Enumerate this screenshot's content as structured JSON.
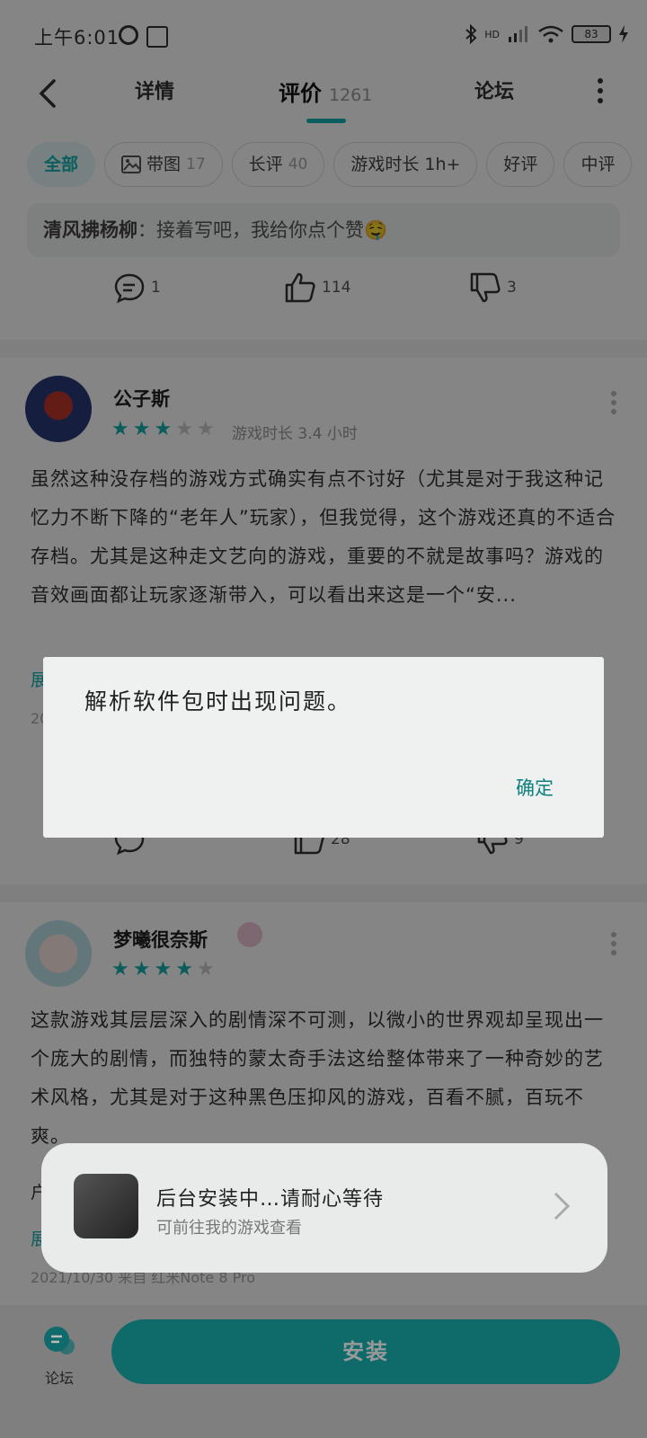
{
  "status": {
    "time": "上午6:01",
    "battery": "83",
    "network": "HD"
  },
  "nav": {
    "tabs": [
      {
        "label": "详情"
      },
      {
        "label": "评价",
        "count": "1261"
      },
      {
        "label": "论坛"
      }
    ]
  },
  "filters": [
    {
      "label": "全部",
      "active": true
    },
    {
      "label": "带图",
      "count": "17"
    },
    {
      "label": "长评",
      "count": "40"
    },
    {
      "label": "游戏时长 1h+"
    },
    {
      "label": "好评"
    },
    {
      "label": "中评"
    }
  ],
  "prev_review": {
    "reply_user": "清风拂杨柳",
    "reply_text": "接着写吧，我给你点个赞🤤",
    "comments": "1",
    "likes": "114",
    "dislikes": "3"
  },
  "review1": {
    "username": "公子斯",
    "rating": 3,
    "playtime": "游戏时长 3.4 小时",
    "text": "虽然这种没存档的游戏方式确实有点不讨好（尤其是对于我这种记忆力不断下降的“老年人”玩家），但我觉得，这个游戏还真的不适合存档。尤其是这种走文艺向的游戏，重要的不就是故事吗？游戏的音效画面都让玩家逐渐带入，可以看出来这是一个“安...",
    "fold": "展",
    "meta": "20",
    "likes": "28",
    "dislikes": "9"
  },
  "review2": {
    "username": "梦曦很奈斯",
    "rating": 4,
    "text": "这款游戏其层层深入的剧情深不可测，以微小的世界观却呈现出一个庞大的剧情，而独特的蒙太奇手法这给整体带来了一种奇妙的艺术风格，尤其是对于这种黑色压抑风的游戏，百看不腻，百玩不爽。",
    "line5_a": "户",
    "line6_a": "展",
    "meta": "2021/10/30  来自 红米Note 8 Pro"
  },
  "dialog": {
    "message": "解析软件包时出现问题。",
    "ok": "确定"
  },
  "toast": {
    "title": "后台安装中…请耐心等待",
    "subtitle": "可前往我的游戏查看"
  },
  "bottom": {
    "forum_label": "论坛",
    "install_label": "安装"
  }
}
